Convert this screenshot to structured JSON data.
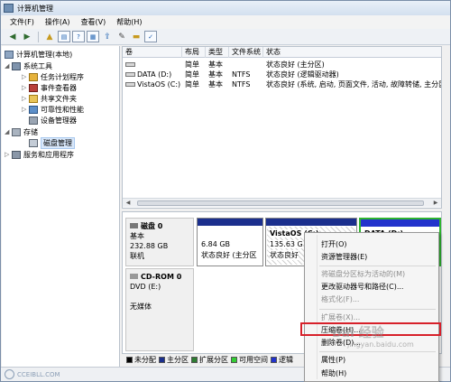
{
  "window": {
    "title": "计算机管理"
  },
  "menu": [
    "文件(F)",
    "操作(A)",
    "查看(V)",
    "帮助(H)"
  ],
  "toolbar_icons": [
    "back-icon",
    "forward-icon",
    "up-folder-icon",
    "show-tree-icon",
    "help-icon",
    "properties-icon",
    "export-icon",
    "folder-icon",
    "disk-icon",
    "view-icon"
  ],
  "tree": {
    "items": [
      {
        "label": "计算机管理(本地)",
        "level": 0,
        "expand": "",
        "icon": "computer-icon"
      },
      {
        "label": "系统工具",
        "level": 1,
        "expand": "◢",
        "icon": "tools-icon"
      },
      {
        "label": "任务计划程序",
        "level": 2,
        "expand": "▷",
        "icon": "task-icon"
      },
      {
        "label": "事件查看器",
        "level": 2,
        "expand": "▷",
        "icon": "event-icon"
      },
      {
        "label": "共享文件夹",
        "level": 2,
        "expand": "▷",
        "icon": "share-icon"
      },
      {
        "label": "可靠性和性能",
        "level": 2,
        "expand": "▷",
        "icon": "perf-icon"
      },
      {
        "label": "设备管理器",
        "level": 2,
        "expand": "",
        "icon": "device-icon"
      },
      {
        "label": "存储",
        "level": 1,
        "expand": "◢",
        "icon": "storage-icon"
      },
      {
        "label": "磁盘管理",
        "level": 2,
        "expand": "",
        "icon": "disk-mgmt-icon",
        "selected": true
      },
      {
        "label": "服务和应用程序",
        "level": 1,
        "expand": "▷",
        "icon": "services-icon"
      }
    ]
  },
  "volume_list": {
    "headers": [
      "卷",
      "布局",
      "类型",
      "文件系统",
      "状态"
    ],
    "rows": [
      [
        "",
        "简单",
        "基本",
        "",
        "状态良好 (主分区)"
      ],
      [
        "DATA (D:)",
        "简单",
        "基本",
        "NTFS",
        "状态良好 (逻辑驱动器)"
      ],
      [
        "VistaOS (C:)",
        "简单",
        "基本",
        "NTFS",
        "状态良好 (系统, 启动, 页面文件, 活动, 故障转储, 主分区)"
      ]
    ]
  },
  "disks": {
    "disk0": {
      "name": "磁盘 0",
      "type": "基本",
      "size": "232.88 GB",
      "state": "联机"
    },
    "cdrom0": {
      "name": "CD-ROM 0",
      "type": "DVD (E:)",
      "media": "无媒体"
    }
  },
  "partitions": {
    "p1": {
      "name": "",
      "size": "6.84 GB",
      "status": "状态良好 (主分区"
    },
    "p2": {
      "name": "VistaOS (C:)",
      "size": "135.63 G",
      "status": "状态良好"
    },
    "p3": {
      "name": "DATA (D:)",
      "size": "",
      "status": ""
    }
  },
  "legend": [
    {
      "label": "未分配",
      "color": "#000000"
    },
    {
      "label": "主分区",
      "color": "#1b2f8d"
    },
    {
      "label": "扩展分区",
      "color": "#2e7d32"
    },
    {
      "label": "可用空间",
      "color": "#33cc33"
    },
    {
      "label": "逻辑",
      "color": "#2233cc"
    }
  ],
  "context_menu": {
    "items": [
      {
        "label": "打开(O)",
        "disabled": false
      },
      {
        "label": "资源管理器(E)",
        "disabled": false
      },
      {
        "sep": true
      },
      {
        "label": "将磁盘分区标为活动的(M)",
        "disabled": true
      },
      {
        "label": "更改驱动器号和路径(C)...",
        "disabled": false
      },
      {
        "label": "格式化(F)...",
        "disabled": true
      },
      {
        "sep": true
      },
      {
        "label": "扩展卷(X)...",
        "disabled": true
      },
      {
        "label": "压缩卷(H)...",
        "disabled": false,
        "highlighted": true
      },
      {
        "label": "删除卷(D)...",
        "disabled": false
      },
      {
        "sep": true
      },
      {
        "label": "属性(P)",
        "disabled": false
      },
      {
        "label": "帮助(H)",
        "disabled": false
      }
    ]
  },
  "watermarks": {
    "bottom_left": "CCEIBLL.COM",
    "baidu": "Bai 经验",
    "baidu_url": "jingyan.baidu.com"
  },
  "colors": {
    "highlight_box": "#d7202a",
    "primary_bar": "#1b2f8d",
    "selected_border": "#2fb52f"
  }
}
